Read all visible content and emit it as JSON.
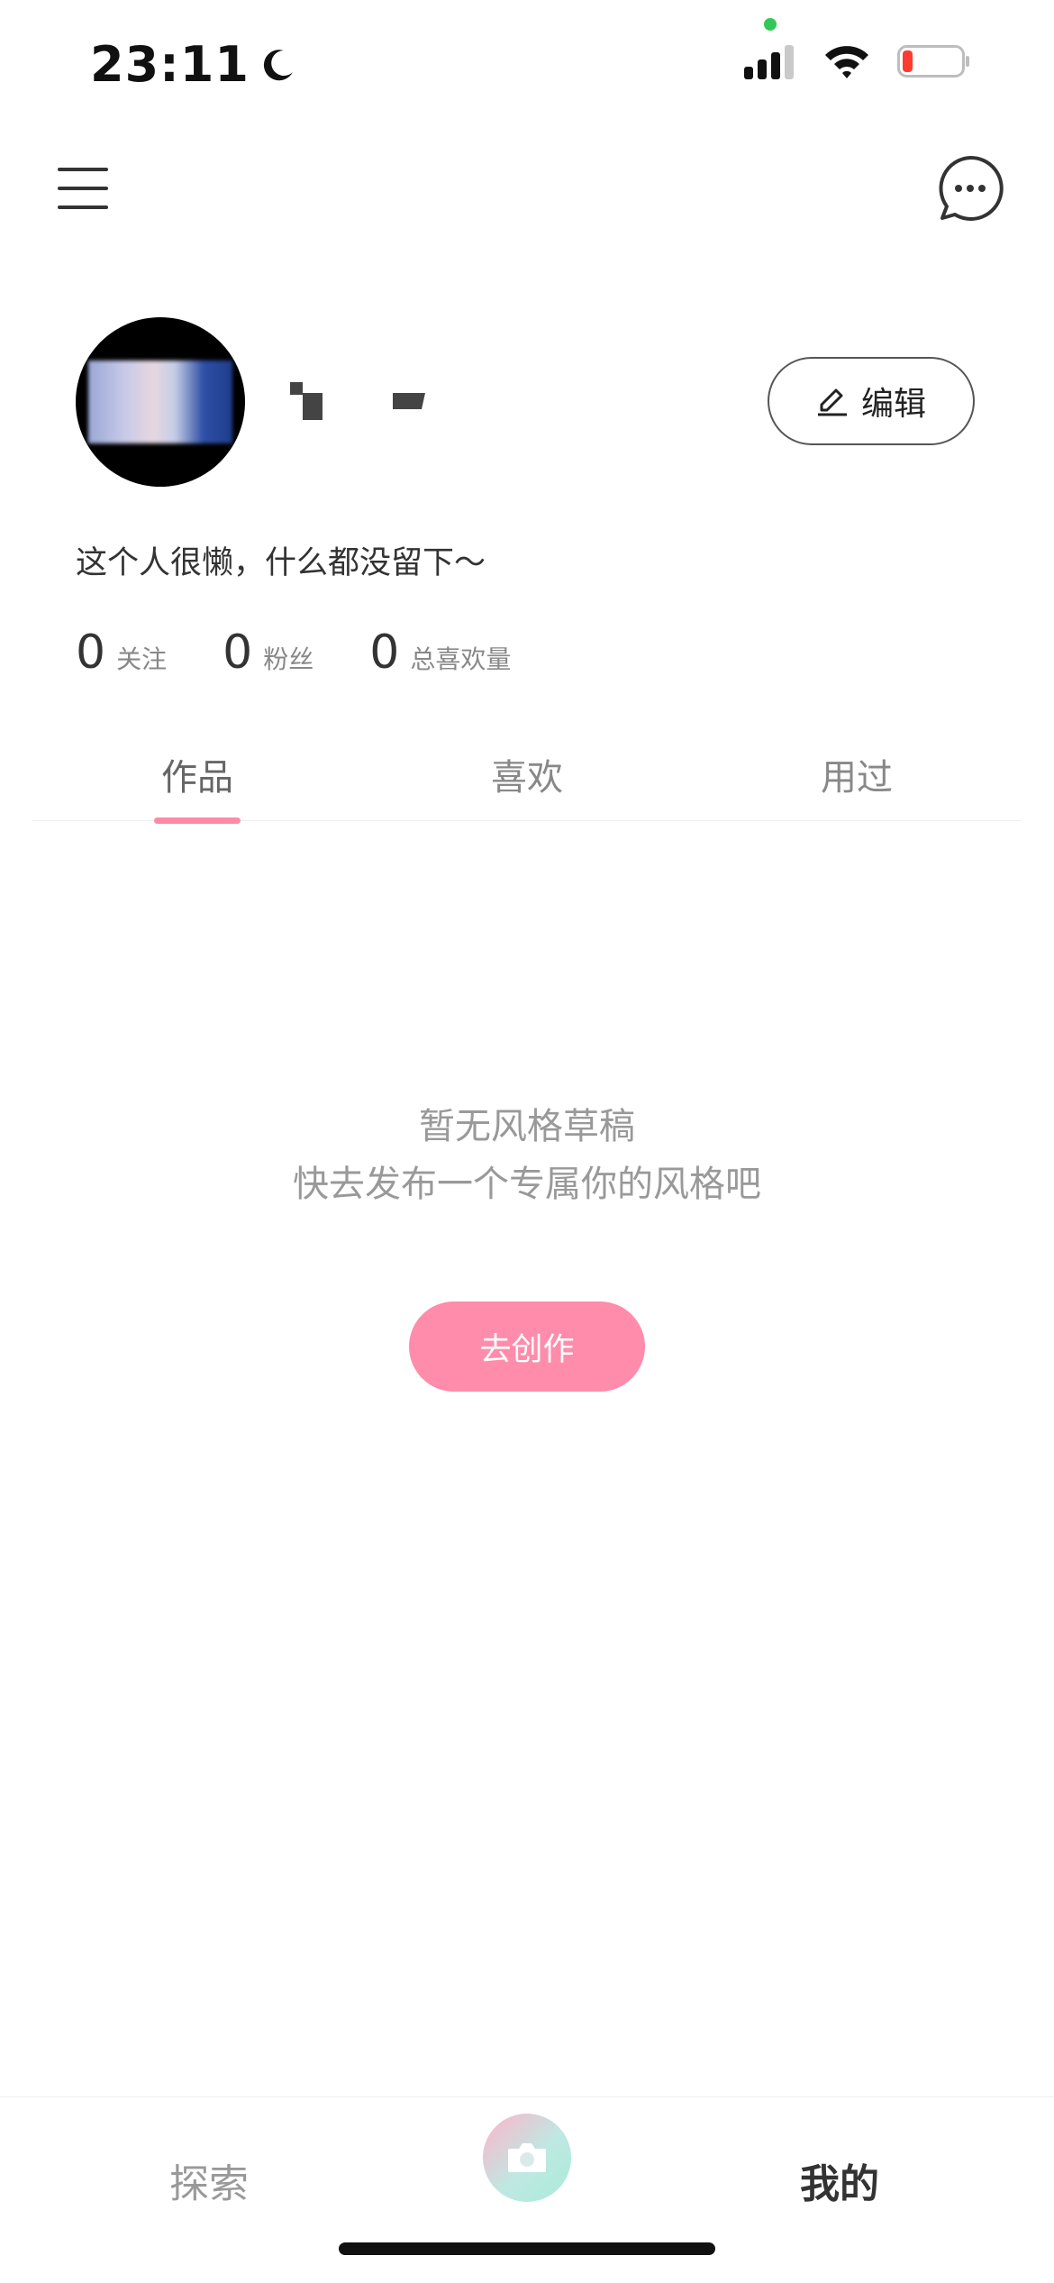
{
  "status_bar": {
    "time": "23:11",
    "icons": [
      "moon-icon",
      "cellular-signal-icon",
      "wifi-icon",
      "battery-low-icon"
    ],
    "battery_level": 0.15,
    "colors": {
      "battery_low": "#ff3b30",
      "indicator_dot": "#33c759"
    }
  },
  "top_bar": {
    "icons": [
      "menu-icon",
      "message-icon"
    ]
  },
  "profile": {
    "edit_label": "编辑",
    "edit_icon": "pencil-icon",
    "bio": "这个人很懒，什么都没留下～",
    "stats": [
      {
        "value": "0",
        "label": "关注"
      },
      {
        "value": "0",
        "label": "粉丝"
      },
      {
        "value": "0",
        "label": "总喜欢量"
      }
    ]
  },
  "tabs": [
    {
      "label": "作品",
      "active": true
    },
    {
      "label": "喜欢",
      "active": false
    },
    {
      "label": "用过",
      "active": false
    }
  ],
  "empty_state": {
    "line1": "暂无风格草稿",
    "line2": "快去发布一个专属你的风格吧",
    "button": "去创作"
  },
  "bottom_nav": {
    "explore": "探索",
    "mine": "我的",
    "center_icon": "camera-icon"
  },
  "colors": {
    "accent_pink": "#ff8cab",
    "text_primary": "#333333",
    "text_secondary": "#999999"
  }
}
